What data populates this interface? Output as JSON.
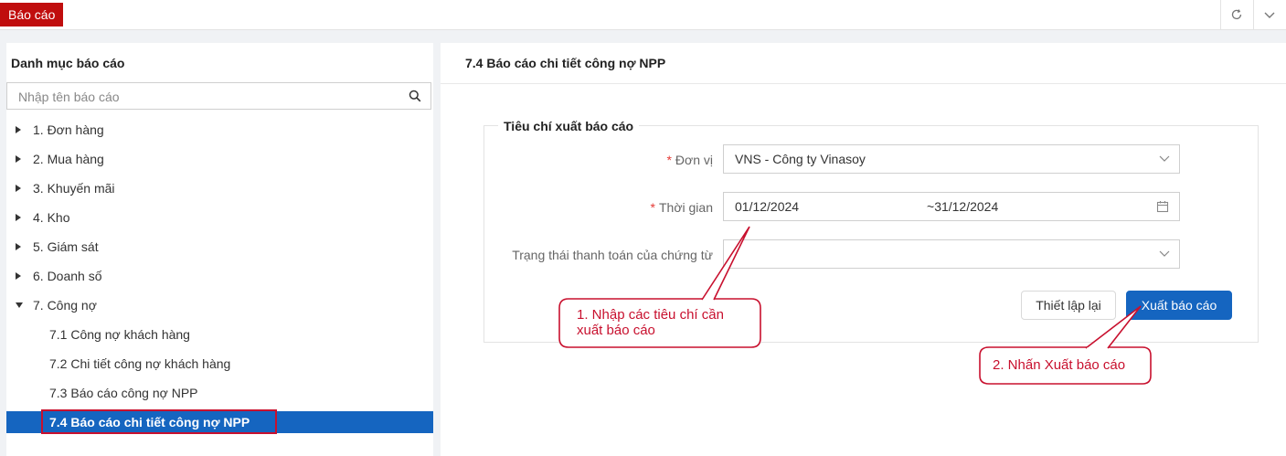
{
  "topbar": {
    "tab_label": "Báo cáo",
    "refresh_icon": "refresh-icon",
    "chevron_icon": "chevron-down-icon"
  },
  "sidebar": {
    "title": "Danh mục báo cáo",
    "search_placeholder": "Nhập tên báo cáo",
    "search_icon": "search-icon",
    "items": [
      {
        "label": "1. Đơn hàng",
        "expanded": false
      },
      {
        "label": "2. Mua hàng",
        "expanded": false
      },
      {
        "label": "3. Khuyến mãi",
        "expanded": false
      },
      {
        "label": "4. Kho",
        "expanded": false
      },
      {
        "label": "5. Giám sát",
        "expanded": false
      },
      {
        "label": "6. Doanh số",
        "expanded": false
      },
      {
        "label": "7. Công nợ",
        "expanded": true
      }
    ],
    "children": [
      {
        "label": "7.1 Công nợ khách hàng"
      },
      {
        "label": "7.2 Chi tiết công nợ khách hàng"
      },
      {
        "label": "7.3 Báo cáo công nợ NPP"
      },
      {
        "label": "7.4 Báo cáo chi tiết công nợ NPP",
        "selected": true
      }
    ]
  },
  "main": {
    "title": "7.4 Báo cáo chi tiết công nợ NPP",
    "criteria_title": "Tiêu chí xuất báo cáo",
    "fields": {
      "unit": {
        "label": "Đơn vị",
        "required": true,
        "value": "VNS - Công ty Vinasoy"
      },
      "time": {
        "label": "Thời gian",
        "required": true,
        "from": "01/12/2024",
        "separator": "~",
        "to": "31/12/2024"
      },
      "payment_status": {
        "label": "Trạng thái thanh toán của chứng từ",
        "required": false,
        "value": ""
      }
    },
    "required_mark": "*",
    "reset_label": "Thiết lập lại",
    "export_label": "Xuất báo cáo"
  },
  "annotations": {
    "callout1_line1": "1. Nhập các tiêu chí cần",
    "callout1_line2": "xuất báo cáo",
    "callout2": "2. Nhấn Xuất báo cáo"
  },
  "colors": {
    "accent": "#1565c0",
    "tab_red": "#c00d0d",
    "annotation_red": "#c8102e"
  }
}
